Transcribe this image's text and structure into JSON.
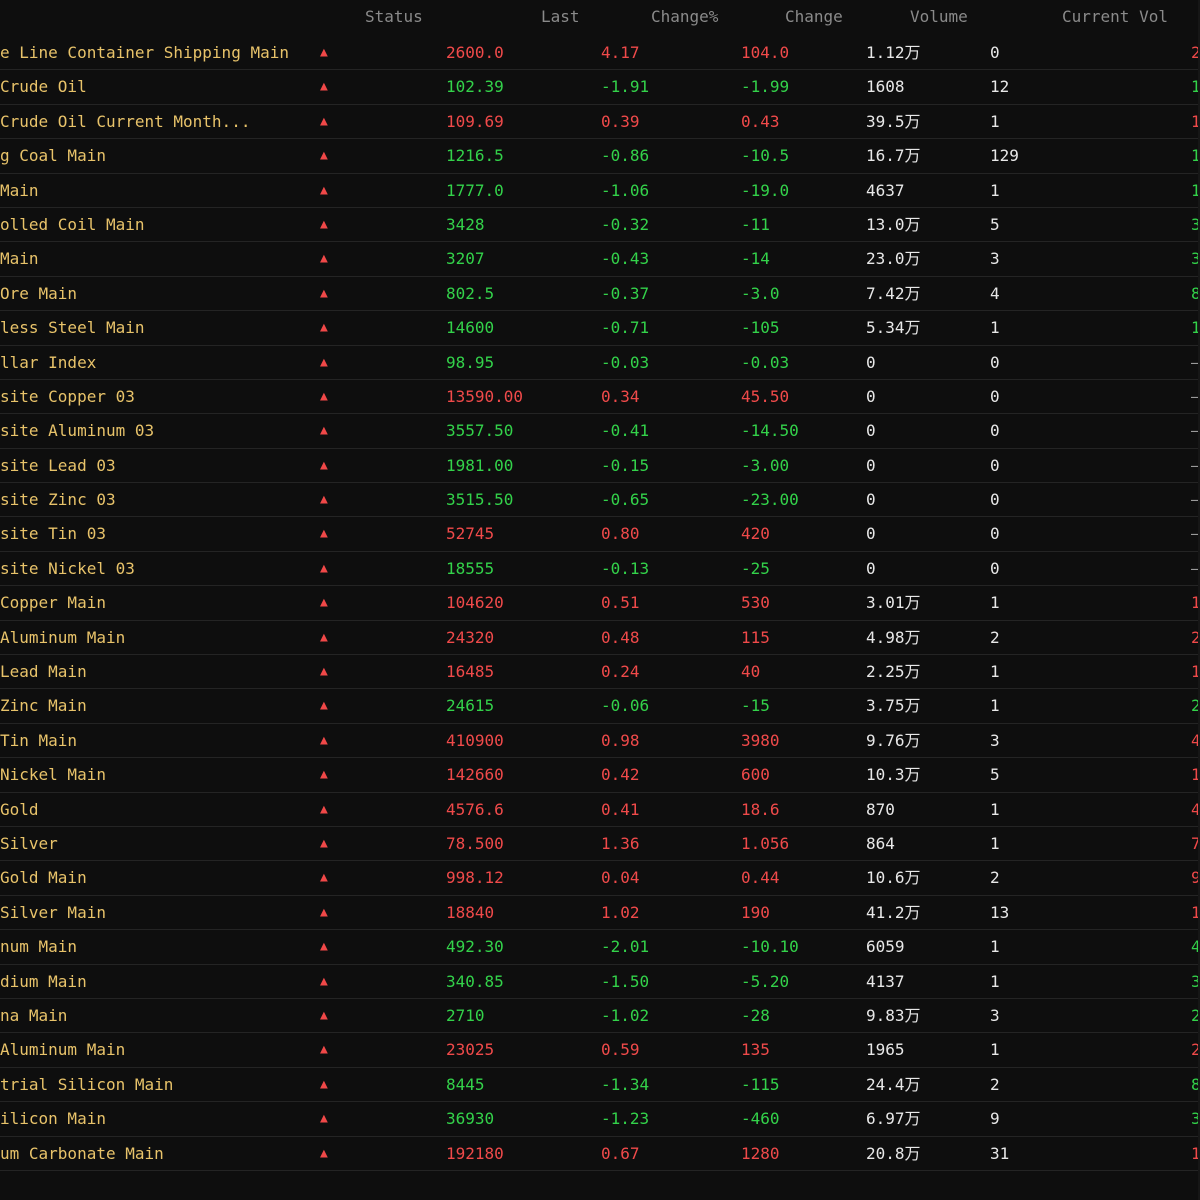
{
  "colors": {
    "background": "#0e0e0e",
    "name": "#e8c36a",
    "up": "#f04a4a",
    "down": "#33d24a",
    "header": "#8a8a8a"
  },
  "header": {
    "status": "Status",
    "last": "Last",
    "change_pct": "Change%",
    "change": "Change",
    "volume": "Volume",
    "current_vol": "Current Vol"
  },
  "rows": [
    {
      "name": "e Line Container Shipping Main",
      "status": "▲",
      "last": "2600.0",
      "pct": "4.17",
      "chg": "104.0",
      "vol": "1.12万",
      "cur": "0",
      "edge": "2",
      "dir": "up"
    },
    {
      "name": " Crude Oil",
      "status": "▲",
      "last": "102.39",
      "pct": "-1.91",
      "chg": "-1.99",
      "vol": "1608",
      "cur": "12",
      "edge": "1",
      "dir": "down"
    },
    {
      "name": " Crude Oil Current Month...",
      "status": "▲",
      "last": "109.69",
      "pct": "0.39",
      "chg": "0.43",
      "vol": "39.5万",
      "cur": "1",
      "edge": "1",
      "dir": "up"
    },
    {
      "name": "g Coal Main",
      "status": "▲",
      "last": "1216.5",
      "pct": "-0.86",
      "chg": "-10.5",
      "vol": "16.7万",
      "cur": "129",
      "edge": "1",
      "dir": "down"
    },
    {
      "name": "Main",
      "status": "▲",
      "last": "1777.0",
      "pct": "-1.06",
      "chg": "-19.0",
      "vol": "4637",
      "cur": "1",
      "edge": "1",
      "dir": "down"
    },
    {
      "name": "olled Coil Main",
      "status": "▲",
      "last": "3428",
      "pct": "-0.32",
      "chg": "-11",
      "vol": "13.0万",
      "cur": "5",
      "edge": "3",
      "dir": "down"
    },
    {
      "name": " Main",
      "status": "▲",
      "last": "3207",
      "pct": "-0.43",
      "chg": "-14",
      "vol": "23.0万",
      "cur": "3",
      "edge": "3",
      "dir": "down"
    },
    {
      "name": "Ore Main",
      "status": "▲",
      "last": "802.5",
      "pct": "-0.37",
      "chg": "-3.0",
      "vol": "7.42万",
      "cur": "4",
      "edge": "8",
      "dir": "down"
    },
    {
      "name": "less Steel Main",
      "status": "▲",
      "last": "14600",
      "pct": "-0.71",
      "chg": "-105",
      "vol": "5.34万",
      "cur": "1",
      "edge": "1",
      "dir": "down"
    },
    {
      "name": "llar Index",
      "status": "▲",
      "last": "98.95",
      "pct": "-0.03",
      "chg": "-0.03",
      "vol": "0",
      "cur": "0",
      "edge": "–",
      "dir": "down"
    },
    {
      "name": "site Copper 03",
      "status": "▲",
      "last": "13590.00",
      "pct": "0.34",
      "chg": "45.50",
      "vol": "0",
      "cur": "0",
      "edge": "–",
      "dir": "up"
    },
    {
      "name": "site Aluminum 03",
      "status": "▲",
      "last": "3557.50",
      "pct": "-0.41",
      "chg": "-14.50",
      "vol": "0",
      "cur": "0",
      "edge": "–",
      "dir": "down"
    },
    {
      "name": "site Lead 03",
      "status": "▲",
      "last": "1981.00",
      "pct": "-0.15",
      "chg": "-3.00",
      "vol": "0",
      "cur": "0",
      "edge": "–",
      "dir": "down"
    },
    {
      "name": "site Zinc 03",
      "status": "▲",
      "last": "3515.50",
      "pct": "-0.65",
      "chg": "-23.00",
      "vol": "0",
      "cur": "0",
      "edge": "–",
      "dir": "down"
    },
    {
      "name": "site Tin 03",
      "status": "▲",
      "last": "52745",
      "pct": "0.80",
      "chg": "420",
      "vol": "0",
      "cur": "0",
      "edge": "–",
      "dir": "up"
    },
    {
      "name": "site Nickel 03",
      "status": "▲",
      "last": "18555",
      "pct": "-0.13",
      "chg": "-25",
      "vol": "0",
      "cur": "0",
      "edge": "–",
      "dir": "down"
    },
    {
      "name": "Copper Main",
      "status": "▲",
      "last": "104620",
      "pct": "0.51",
      "chg": "530",
      "vol": "3.01万",
      "cur": "1",
      "edge": "1",
      "dir": "up"
    },
    {
      "name": "Aluminum Main",
      "status": "▲",
      "last": "24320",
      "pct": "0.48",
      "chg": "115",
      "vol": "4.98万",
      "cur": "2",
      "edge": "2",
      "dir": "up"
    },
    {
      "name": "Lead Main",
      "status": "▲",
      "last": "16485",
      "pct": "0.24",
      "chg": "40",
      "vol": "2.25万",
      "cur": "1",
      "edge": "1",
      "dir": "up"
    },
    {
      "name": "Zinc Main",
      "status": "▲",
      "last": "24615",
      "pct": "-0.06",
      "chg": "-15",
      "vol": "3.75万",
      "cur": "1",
      "edge": "2",
      "dir": "down"
    },
    {
      "name": "Tin Main",
      "status": "▲",
      "last": "410900",
      "pct": "0.98",
      "chg": "3980",
      "vol": "9.76万",
      "cur": "3",
      "edge": "4",
      "dir": "up"
    },
    {
      "name": "Nickel Main",
      "status": "▲",
      "last": "142660",
      "pct": "0.42",
      "chg": "600",
      "vol": "10.3万",
      "cur": "5",
      "edge": "1",
      "dir": "up"
    },
    {
      "name": " Gold",
      "status": "▲",
      "last": "4576.6",
      "pct": "0.41",
      "chg": "18.6",
      "vol": "870",
      "cur": "1",
      "edge": "4",
      "dir": "up"
    },
    {
      "name": " Silver",
      "status": "▲",
      "last": "78.500",
      "pct": "1.36",
      "chg": "1.056",
      "vol": "864",
      "cur": "1",
      "edge": "7",
      "dir": "up"
    },
    {
      "name": "Gold Main",
      "status": "▲",
      "last": "998.12",
      "pct": "0.04",
      "chg": "0.44",
      "vol": "10.6万",
      "cur": "2",
      "edge": "9",
      "dir": "up"
    },
    {
      "name": "Silver Main",
      "status": "▲",
      "last": "18840",
      "pct": "1.02",
      "chg": "190",
      "vol": "41.2万",
      "cur": "13",
      "edge": "1",
      "dir": "up"
    },
    {
      "name": "num Main",
      "status": "▲",
      "last": "492.30",
      "pct": "-2.01",
      "chg": "-10.10",
      "vol": "6059",
      "cur": "1",
      "edge": "4",
      "dir": "down"
    },
    {
      "name": "dium Main",
      "status": "▲",
      "last": "340.85",
      "pct": "-1.50",
      "chg": "-5.20",
      "vol": "4137",
      "cur": "1",
      "edge": "3",
      "dir": "down"
    },
    {
      "name": "na Main",
      "status": "▲",
      "last": "2710",
      "pct": "-1.02",
      "chg": "-28",
      "vol": "9.83万",
      "cur": "3",
      "edge": "2",
      "dir": "down"
    },
    {
      "name": "Aluminum Main",
      "status": "▲",
      "last": "23025",
      "pct": "0.59",
      "chg": "135",
      "vol": "1965",
      "cur": "1",
      "edge": "2",
      "dir": "up"
    },
    {
      "name": "trial Silicon Main",
      "status": "▲",
      "last": "8445",
      "pct": "-1.34",
      "chg": "-115",
      "vol": "24.4万",
      "cur": "2",
      "edge": "8",
      "dir": "down"
    },
    {
      "name": "ilicon Main",
      "status": "▲",
      "last": "36930",
      "pct": "-1.23",
      "chg": "-460",
      "vol": "6.97万",
      "cur": "9",
      "edge": "3",
      "dir": "down"
    },
    {
      "name": "um Carbonate Main",
      "status": "▲",
      "last": "192180",
      "pct": "0.67",
      "chg": "1280",
      "vol": "20.8万",
      "cur": "31",
      "edge": "1",
      "dir": "up"
    }
  ]
}
